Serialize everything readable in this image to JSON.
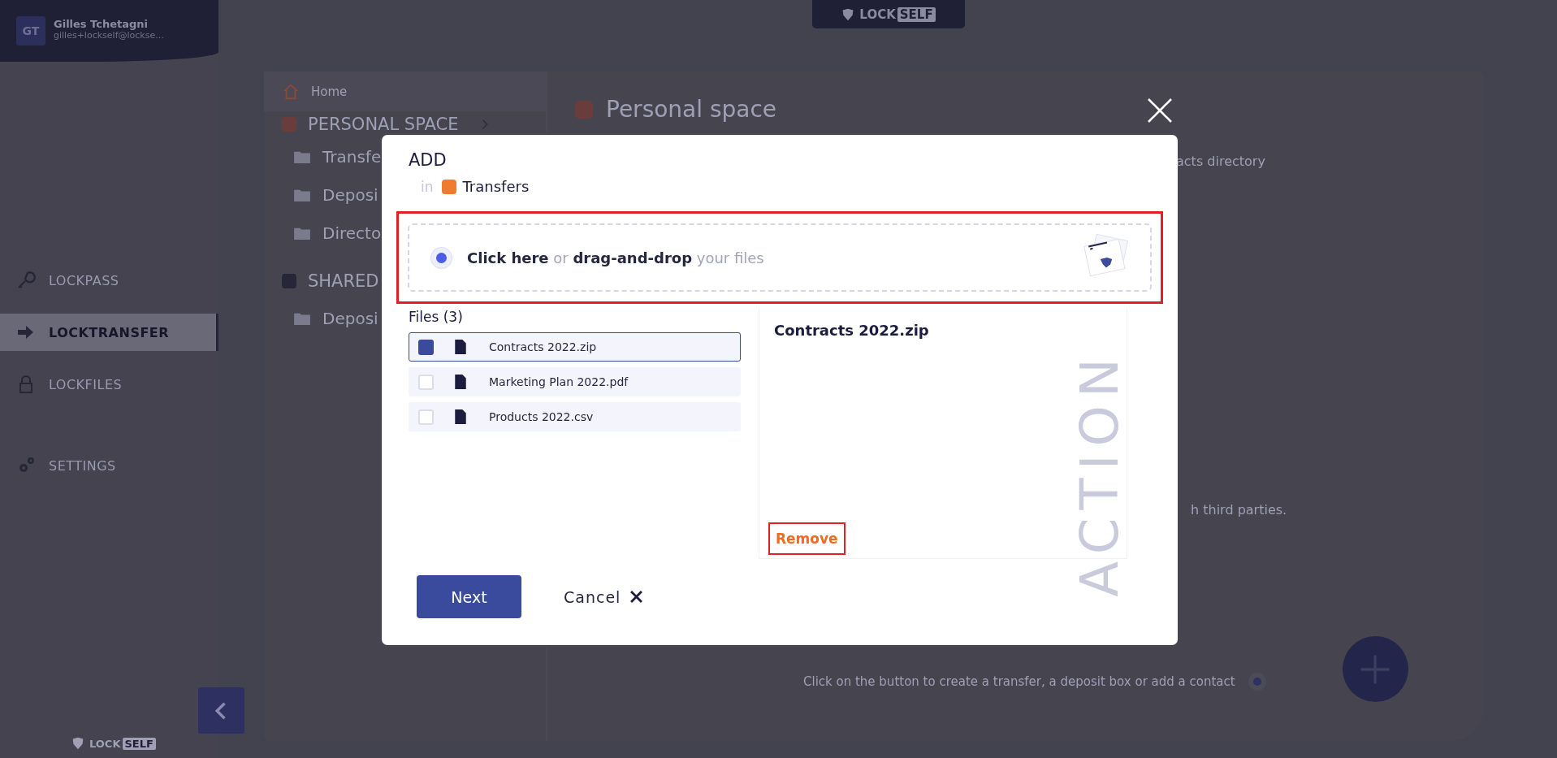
{
  "sidebar": {
    "user": {
      "initials": "GT",
      "name": "Gilles Tchetagni",
      "email": "gilles+lockself@lockse..."
    },
    "nav": [
      {
        "label": "LOCKPASS",
        "selected": false
      },
      {
        "label": "LOCKTRANSFER",
        "selected": true
      },
      {
        "label": "LOCKFILES",
        "selected": false
      },
      {
        "label": "SETTINGS",
        "selected": false
      }
    ],
    "logo": {
      "word": "LOCK",
      "badge": "SELF"
    }
  },
  "top_logo": {
    "word": "LOCK",
    "badge": "SELF"
  },
  "tree": {
    "home": "Home",
    "sections": [
      {
        "title": "PERSONAL SPACE",
        "kind": "personal",
        "items": [
          "Transfe",
          "Deposi",
          "Directo"
        ]
      },
      {
        "title": "SHARED",
        "kind": "shared",
        "items": [
          "Deposi"
        ]
      }
    ]
  },
  "content": {
    "title": "Personal space",
    "fragments": [
      "acts directory",
      "h third parties."
    ],
    "hint": "Click on the button to create a transfer, a deposit box or add a contact"
  },
  "modal": {
    "title": "ADD",
    "in_label": "in",
    "folder": "Transfers",
    "dropzone": "**Click here** or **drag-and-drop** your files",
    "watermark": "ACTION",
    "files_heading": "Files (3)",
    "files": [
      {
        "name": "Contracts 2022.zip",
        "selected": true
      },
      {
        "name": "Marketing Plan 2022.pdf",
        "selected": false
      },
      {
        "name": "Products 2022.csv",
        "selected": false
      }
    ],
    "preview": {
      "name": "Contracts 2022.zip",
      "remove": "Remove"
    },
    "next": "Next",
    "cancel": "Cancel"
  }
}
